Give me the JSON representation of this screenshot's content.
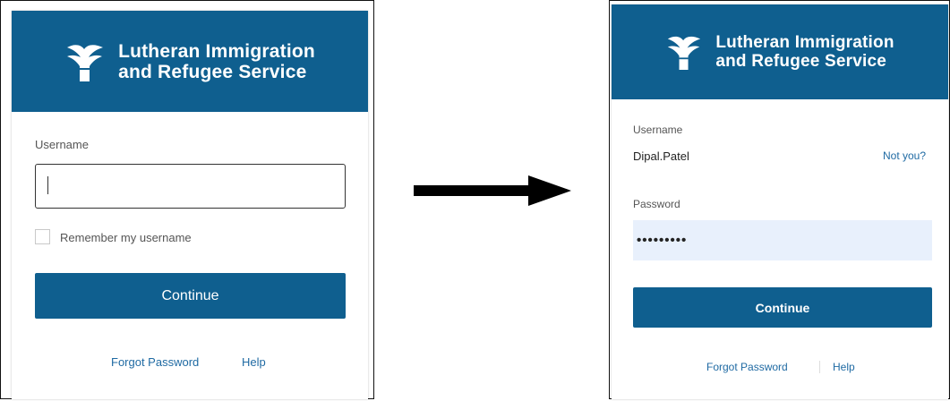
{
  "colors": {
    "brand": "#0f5f8f",
    "link": "#1f6aa3",
    "autofill": "#e8f0fc"
  },
  "brand": {
    "line1": "Lutheran Immigration",
    "line2": "and Refugee Service",
    "logo_icon": "lirs-torch-logo-icon"
  },
  "step1": {
    "username_label": "Username",
    "username_value": "",
    "remember_label": "Remember my username",
    "continue_label": "Continue",
    "forgot_label": "Forgot Password",
    "help_label": "Help"
  },
  "arrow_icon": "right-arrow-icon",
  "step2": {
    "username_label": "Username",
    "username_value": "Dipal.Patel",
    "not_you_label": "Not you?",
    "password_label": "Password",
    "password_value": "•••••••••",
    "continue_label": "Continue",
    "forgot_label": "Forgot Password",
    "help_label": "Help"
  }
}
